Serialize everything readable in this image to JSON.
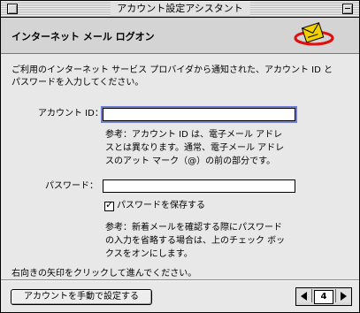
{
  "window": {
    "title": "アカウント設定アシスタント"
  },
  "header": {
    "title": "インターネット メール ログオン",
    "icon": "mail-envelope-icon"
  },
  "intro": [
    "ご利用のインターネット サービス プロバイダから通知された、アカウント ID と",
    "パスワードを入力してください。"
  ],
  "account_id": {
    "label": "アカウント ID：",
    "value": "",
    "note": [
      "参考：アカウント ID は、電子メール アドレ",
      "スとは異なります。通常、電子メール アドレ",
      "スのアット マーク（@）の前の部分です。"
    ]
  },
  "password": {
    "label": "パスワード：",
    "value": "",
    "save_checkbox": {
      "label": "パスワードを保存する",
      "checked": true
    },
    "note": [
      "参考：新着メールを確認する際にパスワード",
      "の入力を省略する場合は、上のチェック ボッ",
      "クスをオンにします。"
    ]
  },
  "instruction": "右向きの矢印をクリックして進んでください。",
  "footer": {
    "manual_button": "アカウントを手動で設定する",
    "page_number": "4"
  }
}
